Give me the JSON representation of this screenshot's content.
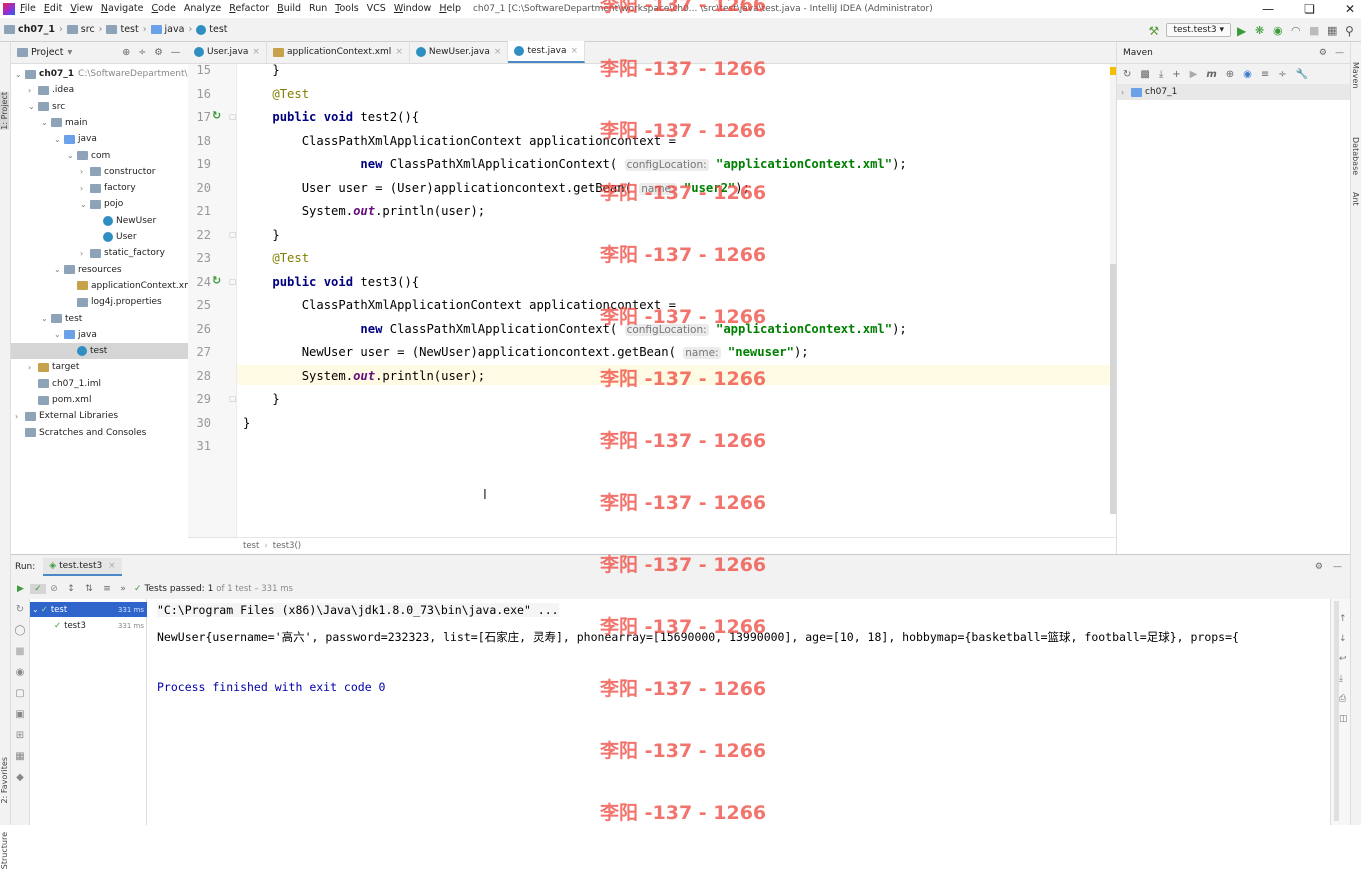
{
  "titlebar": {
    "menu": [
      {
        "u": "F",
        "rest": "ile"
      },
      {
        "u": "E",
        "rest": "dit"
      },
      {
        "u": "V",
        "rest": "iew"
      },
      {
        "u": "N",
        "rest": "avigate"
      },
      {
        "u": "C",
        "rest": "ode"
      },
      {
        "u": "",
        "rest": "Analyze"
      },
      {
        "u": "R",
        "rest": "efactor"
      },
      {
        "u": "B",
        "rest": "uild"
      },
      {
        "u": "",
        "rest": "Run"
      },
      {
        "u": "T",
        "rest": "ools"
      },
      {
        "u": "",
        "rest": "VCS"
      },
      {
        "u": "W",
        "rest": "indow"
      },
      {
        "u": "H",
        "rest": "elp"
      }
    ],
    "window_title": "ch07_1 [C:\\SoftwareDepartment\\workspace\\ch0... \\src\\test\\java\\test.java - IntelliJ IDEA (Administrator)"
  },
  "navbar": {
    "crumbs": [
      "ch07_1",
      "src",
      "test",
      "java",
      "test"
    ],
    "run_config": "test.test3"
  },
  "project": {
    "header": "Project",
    "tree": [
      {
        "label": "ch07_1",
        "extra": "C:\\SoftwareDepartment\\works",
        "depth": 0,
        "arrow": "v",
        "icon": "folder"
      },
      {
        "label": ".idea",
        "depth": 1,
        "arrow": ">",
        "icon": "folder"
      },
      {
        "label": "src",
        "depth": 1,
        "arrow": "v",
        "icon": "folder"
      },
      {
        "label": "main",
        "depth": 2,
        "arrow": "v",
        "icon": "folder"
      },
      {
        "label": "java",
        "depth": 3,
        "arrow": "v",
        "icon": "folder-blue"
      },
      {
        "label": "com",
        "depth": 4,
        "arrow": "v",
        "icon": "package"
      },
      {
        "label": "constructor",
        "depth": 5,
        "arrow": ">",
        "icon": "package"
      },
      {
        "label": "factory",
        "depth": 5,
        "arrow": ">",
        "icon": "package"
      },
      {
        "label": "pojo",
        "depth": 5,
        "arrow": "v",
        "icon": "package"
      },
      {
        "label": "NewUser",
        "depth": 6,
        "arrow": "",
        "icon": "class"
      },
      {
        "label": "User",
        "depth": 6,
        "arrow": "",
        "icon": "class"
      },
      {
        "label": "static_factory",
        "depth": 5,
        "arrow": ">",
        "icon": "package"
      },
      {
        "label": "resources",
        "depth": 3,
        "arrow": "v",
        "icon": "folder-res"
      },
      {
        "label": "applicationContext.xml",
        "depth": 4,
        "arrow": "",
        "icon": "xml"
      },
      {
        "label": "log4j.properties",
        "depth": 4,
        "arrow": "",
        "icon": "props"
      },
      {
        "label": "test",
        "depth": 2,
        "arrow": "v",
        "icon": "folder"
      },
      {
        "label": "java",
        "depth": 3,
        "arrow": "v",
        "icon": "folder-green"
      },
      {
        "label": "test",
        "depth": 4,
        "arrow": "",
        "icon": "class",
        "selected": true
      },
      {
        "label": "target",
        "depth": 1,
        "arrow": ">",
        "icon": "folder-ok"
      },
      {
        "label": "ch07_1.iml",
        "depth": 1,
        "arrow": "",
        "icon": "iml"
      },
      {
        "label": "pom.xml",
        "depth": 1,
        "arrow": "",
        "icon": "maven"
      },
      {
        "label": "External Libraries",
        "depth": 0,
        "arrow": ">",
        "icon": "lib"
      },
      {
        "label": "Scratches and Consoles",
        "depth": 0,
        "arrow": "",
        "icon": "scratch"
      }
    ]
  },
  "tabs": [
    {
      "label": "User.java",
      "icon": "class"
    },
    {
      "label": "applicationContext.xml",
      "icon": "xml"
    },
    {
      "label": "NewUser.java",
      "icon": "class"
    },
    {
      "label": "test.java",
      "icon": "class",
      "active": true
    }
  ],
  "editor": {
    "lines": [
      {
        "n": "15",
        "html": "    }"
      },
      {
        "n": "16",
        "html": "    <span class=\"an\">@Test</span>"
      },
      {
        "n": "17",
        "html": "    <span class=\"kw\">public void</span> test2(){"
      },
      {
        "n": "18",
        "html": "        ClassPathXmlApplicationContext applicationcontext ="
      },
      {
        "n": "19",
        "html": "                <span class=\"kw\">new</span> ClassPathXmlApplicationContext( <span class=\"hint\">configLocation:</span> <span class=\"st\">\"applicationContext.xml\"</span>);"
      },
      {
        "n": "20",
        "html": "        User user = (User)applicationcontext.getBean( <span class=\"hint\">name:</span> <span class=\"st\">\"user2\"</span>);"
      },
      {
        "n": "21",
        "html": "        System.<span class=\"it\">out</span>.println(user);"
      },
      {
        "n": "22",
        "html": "    }"
      },
      {
        "n": "23",
        "html": "    <span class=\"an\">@Test</span>"
      },
      {
        "n": "24",
        "html": "    <span class=\"kw\">public void</span> test3(){"
      },
      {
        "n": "25",
        "html": "        ClassPathXmlApplicationContext applicationcontext ="
      },
      {
        "n": "26",
        "html": "                <span class=\"kw\">new</span> ClassPathXmlApplicationContext( <span class=\"hint\">configLocation:</span> <span class=\"st\">\"applicationContext.xml\"</span>);"
      },
      {
        "n": "27",
        "html": "        NewUser user = (NewUser)applicationcontext.getBean( <span class=\"hint\">name:</span> <span class=\"st\">\"newuser\"</span>);"
      },
      {
        "n": "28",
        "html": "        System.<span class=\"it\">out</span>.println(user);"
      },
      {
        "n": "29",
        "html": "    }"
      },
      {
        "n": "30",
        "html": "}"
      },
      {
        "n": "31",
        "html": ""
      }
    ],
    "breadcrumb": [
      "test",
      "test3()"
    ]
  },
  "maven": {
    "title": "Maven",
    "project": "ch07_1"
  },
  "run": {
    "label": "Run:",
    "tab": "test.test3",
    "status": "Tests passed: 1",
    "status_detail": "of 1 test – 331 ms",
    "tree": [
      {
        "label": "test",
        "time": "331 ms",
        "depth": 0
      },
      {
        "label": "test3",
        "time": "331 ms",
        "depth": 1
      }
    ],
    "console": [
      {
        "text": "\"C:\\Program Files (x86)\\Java\\jdk1.8.0_73\\bin\\java.exe\" ...",
        "color": "#000"
      },
      {
        "text": "NewUser{username='高六', password=232323, list=[石家庄, 灵寿], phonearray=[15690000, 13990000], age=[10, 18], hobbymap={basketball=篮球, football=足球}, props={",
        "color": "#000"
      },
      {
        "text": "",
        "color": "#000"
      },
      {
        "text": "Process finished with exit code 0",
        "color": "#0000aa"
      }
    ]
  },
  "side": {
    "project": "1: Project",
    "favorites": "2: Favorites",
    "structure": "Structure",
    "maven": "Maven",
    "database": "Database",
    "ant": "Ant"
  },
  "watermark": "李阳 -137 - 1266"
}
